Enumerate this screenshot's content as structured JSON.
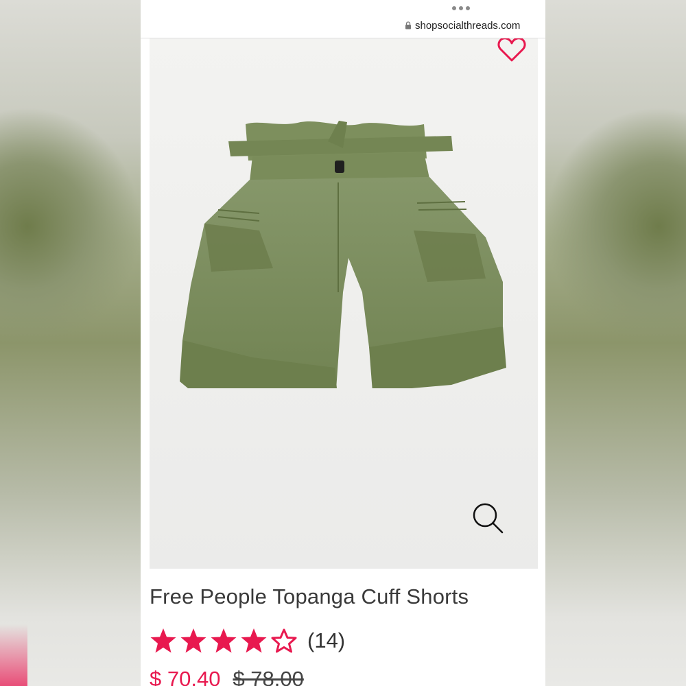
{
  "browser": {
    "url": "shopsocialthreads.com",
    "menu_icon": "more-dots-icon",
    "lock_icon": "lock-icon"
  },
  "product": {
    "title": "Free People Topanga Cuff Shorts",
    "rating": 4,
    "rating_max": 5,
    "review_count": "(14)",
    "sale_price": "$ 70.40",
    "original_price": "$ 78.00",
    "favorite_icon": "heart-icon",
    "zoom_icon": "magnifier-icon",
    "image": "olive-green-paperbag-shorts"
  },
  "colors": {
    "accent": "#e8194f",
    "star": "#e8194f",
    "text": "#3a3a3a",
    "shorts": "#7a8c58"
  }
}
